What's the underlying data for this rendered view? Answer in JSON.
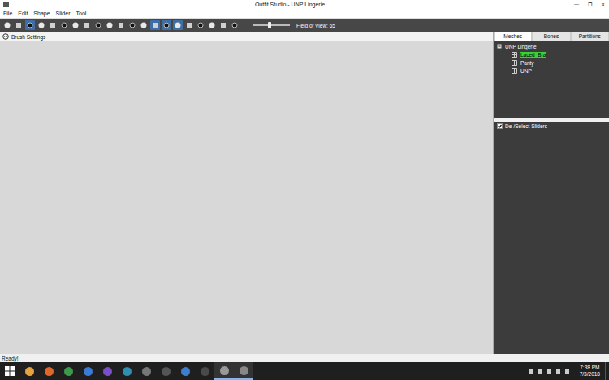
{
  "window": {
    "title": "Outfit Studio - UNP Lingerie",
    "controls": [
      "—",
      "❐",
      "✕"
    ]
  },
  "menu": [
    "File",
    "Edit",
    "Shape",
    "Slider",
    "Tool"
  ],
  "toolbar": {
    "tools": [
      {
        "selected": false
      },
      {
        "selected": false
      },
      {
        "selected": true
      },
      {
        "selected": false
      },
      {
        "selected": false
      },
      {
        "selected": false
      },
      {
        "selected": false
      },
      {
        "selected": false
      },
      {
        "selected": false
      },
      {
        "selected": false
      },
      {
        "selected": false
      },
      {
        "selected": false
      },
      {
        "selected": false
      },
      {
        "selected": true
      },
      {
        "selected": true
      },
      {
        "selected": true
      },
      {
        "selected": false
      },
      {
        "selected": false
      },
      {
        "selected": false
      },
      {
        "selected": false
      },
      {
        "selected": false
      }
    ],
    "fov": {
      "label": "Field of View: 65",
      "level": 0.45
    }
  },
  "brush_settings": {
    "label": "Brush Settings",
    "expanded": false
  },
  "tabs": [
    {
      "label": "Meshes",
      "selected": true
    },
    {
      "label": "Bones",
      "selected": false
    },
    {
      "label": "Partitions",
      "selected": false
    }
  ],
  "tree": {
    "root": "UNP Lingerie",
    "expanded": true,
    "items": [
      {
        "label": "Laced_Bra",
        "selected": true
      },
      {
        "label": "Panty",
        "selected": false
      },
      {
        "label": "UNP",
        "selected": false
      }
    ]
  },
  "sliders": {
    "label": "De-/Select Sliders",
    "checked": true
  },
  "status_bar": "Ready!",
  "taskbar": {
    "apps": [
      {
        "selected": false
      },
      {
        "selected": false
      },
      {
        "selected": false
      },
      {
        "selected": false
      },
      {
        "selected": false
      },
      {
        "selected": false
      },
      {
        "selected": false
      },
      {
        "selected": false
      },
      {
        "selected": false
      },
      {
        "selected": false
      },
      {
        "selected": true
      },
      {
        "selected": true
      }
    ],
    "time": "7:38 PM",
    "date": "7/3/2018"
  }
}
